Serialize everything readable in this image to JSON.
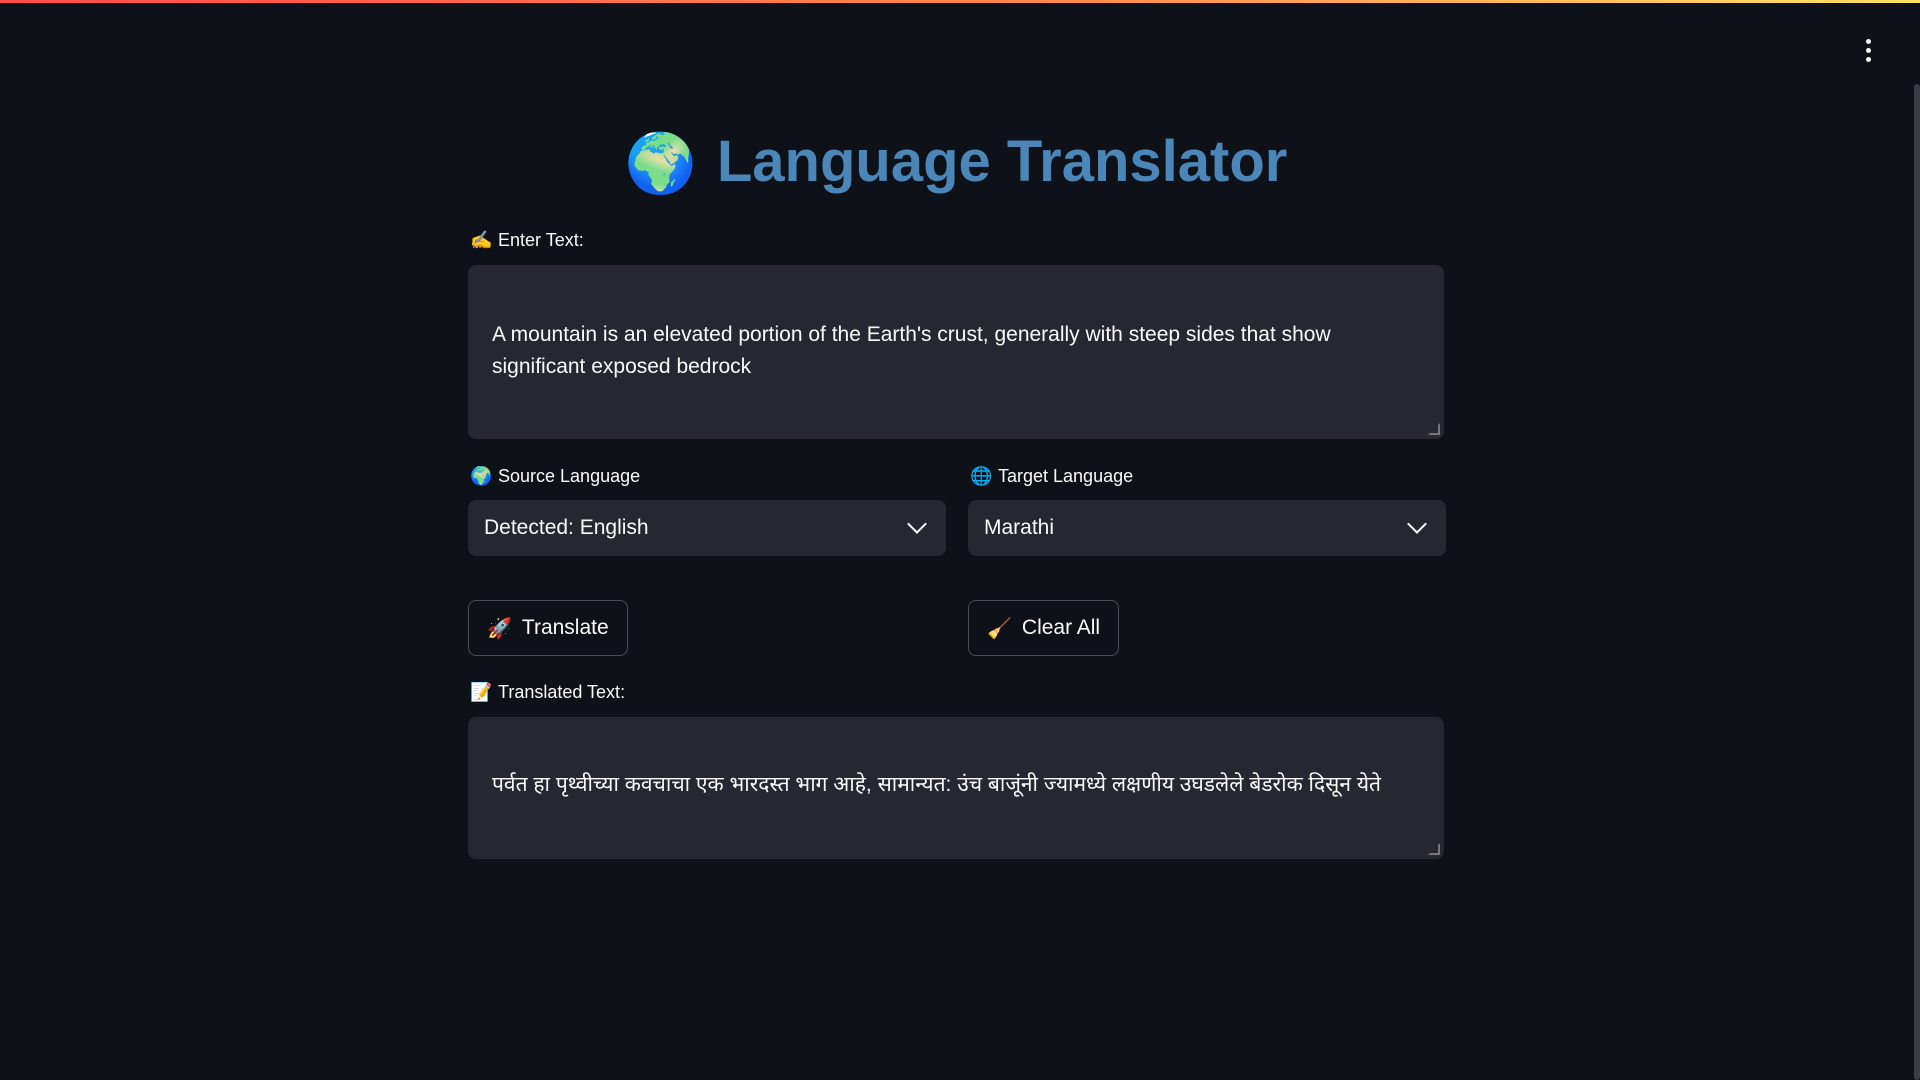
{
  "app": {
    "title": "Language Translator",
    "title_icon": "🌍",
    "menu_icon": "more-vertical-icon"
  },
  "input": {
    "label": "Enter Text:",
    "label_icon": "✍️",
    "value": "A mountain is an elevated portion of the Earth's crust, generally with steep sides that show significant exposed bedrock"
  },
  "source_language": {
    "label": "Source Language",
    "label_icon": "🌍",
    "selected": "Detected: English"
  },
  "target_language": {
    "label": "Target Language",
    "label_icon": "🌐",
    "selected": "Marathi"
  },
  "buttons": {
    "translate_label": "Translate",
    "translate_icon": "🚀",
    "clear_label": "Clear All",
    "clear_icon": "🧹"
  },
  "output": {
    "label": "Translated Text:",
    "label_icon": "📝",
    "value": "पर्वत हा पृथ्वीच्या कवचाचा एक भारदस्त भाग आहे, सामान्यत: उंच बाजूंनी ज्यामध्ये लक्षणीय उघडलेले बेडरोक दिसून येते"
  },
  "colors": {
    "background": "#0e1117",
    "field": "#262730",
    "title": "#4a86b8"
  }
}
